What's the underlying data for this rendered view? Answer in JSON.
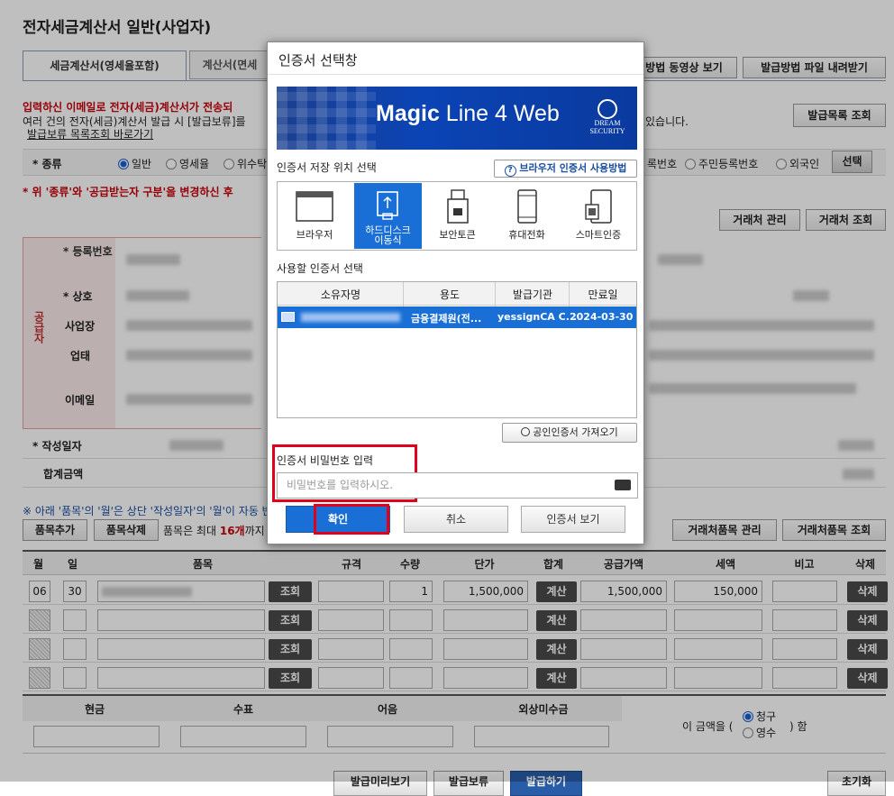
{
  "page": {
    "title": "전자세금계산서 일반(사업자)"
  },
  "tabs": [
    {
      "label": "세금계산서(영세율포함)"
    },
    {
      "label": "계산서(면세"
    }
  ],
  "top_buttons": {
    "video": "방법 동영상 보기",
    "download": "발급방법 파일 내려받기",
    "list": "발급목록 조회"
  },
  "notice": {
    "line1": "입력하신 이메일로 전자(세금)계산서가 전송되",
    "line2": "여러 건의 전자(세금)계산서 발급 시 [발급보류]를",
    "line2_tail": "있습니다.",
    "link": "발급보류 목록조회 바로가기"
  },
  "kind": {
    "label": "* 종류",
    "opt1": "일반",
    "opt2": "영세율",
    "opt3": "위수탁"
  },
  "buyer_type": {
    "opt_biz": "록번호",
    "opt_resident": "주민등록번호",
    "opt_foreign": "외국인",
    "select_btn": "선택"
  },
  "warn": "* 위 '종류'와 '공급받는자 구분'을 변경하신 후",
  "client_buttons": {
    "manage": "거래처 관리",
    "search": "거래처 조회"
  },
  "supplier": {
    "section": "공급자",
    "reg_no": "* 등록번호",
    "name": "* 상호",
    "address": "사업장",
    "business": "업태",
    "email": "이메일"
  },
  "write_date": "* 작성일자",
  "total": "합계금액",
  "item_note": "※ 아래 '품목'의 '월'은 상단 '작성일자'의 '월'이 자동 반",
  "item_controls": {
    "add": "품목추가",
    "del": "품목삭제",
    "max_text": "품목은 최대 ",
    "max_num": "16개",
    "max_tail": "까지"
  },
  "item_client_buttons": {
    "manage": "거래처품목 관리",
    "search": "거래처품목 조회"
  },
  "items_table": {
    "headers": [
      "월",
      "일",
      "품목",
      "규격",
      "수량",
      "단가",
      "합계",
      "공급가액",
      "세액",
      "비고",
      "삭제"
    ],
    "row1": {
      "month": "06",
      "day": "30",
      "qty": "1",
      "unit_price": "1,500,000",
      "supply": "1,500,000",
      "tax": "150,000"
    },
    "lookup": "조회",
    "calc": "계산",
    "del": "삭제"
  },
  "pay_table": {
    "headers": [
      "현금",
      "수표",
      "어음",
      "외상미수금"
    ],
    "label_pre": "이 금액을 (",
    "opt_claim": "청구",
    "opt_receipt": "영수",
    "label_post": ") 함"
  },
  "bottom_buttons": [
    "발급미리보기",
    "발급보류",
    "발급하기",
    "초기화"
  ],
  "dialog": {
    "title": "인증서 선택창",
    "banner": {
      "brand_bold": "Magic",
      "brand_rest": " Line 4 Web",
      "vendor_top": "DREAM",
      "vendor_bottom": "SECURITY"
    },
    "storage_label": "인증서 저장 위치 선택",
    "help_link": "브라우저 인증서 사용방법",
    "storage": [
      {
        "label": "브라우저",
        "icon": "browser-icon"
      },
      {
        "label": "하드디스크\n이동식",
        "icon": "usb-drive-icon"
      },
      {
        "label": "보안토큰",
        "icon": "security-token-icon"
      },
      {
        "label": "휴대전화",
        "icon": "mobile-phone-icon"
      },
      {
        "label": "스마트인증",
        "icon": "smart-auth-icon"
      }
    ],
    "cert_label": "사용할 인증서 선택",
    "cert_headers": [
      "소유자명",
      "용도",
      "발급기관",
      "만료일"
    ],
    "cert_row": {
      "usage": "금융결제원(전...",
      "issuer": "yessignCA C...",
      "expiry": "2024-03-30"
    },
    "import_btn": "공인인증서 가져오기",
    "pw_label": "인증서 비밀번호 입력",
    "pw_placeholder": "비밀번호를 입력하시오.",
    "ok": "확인",
    "cancel": "취소",
    "view": "인증서 보기"
  },
  "colors": {
    "accent": "#1a5fd0",
    "banner": "#0a3a9e",
    "highlight": "#e0001b",
    "notice_red": "#c8000a"
  }
}
